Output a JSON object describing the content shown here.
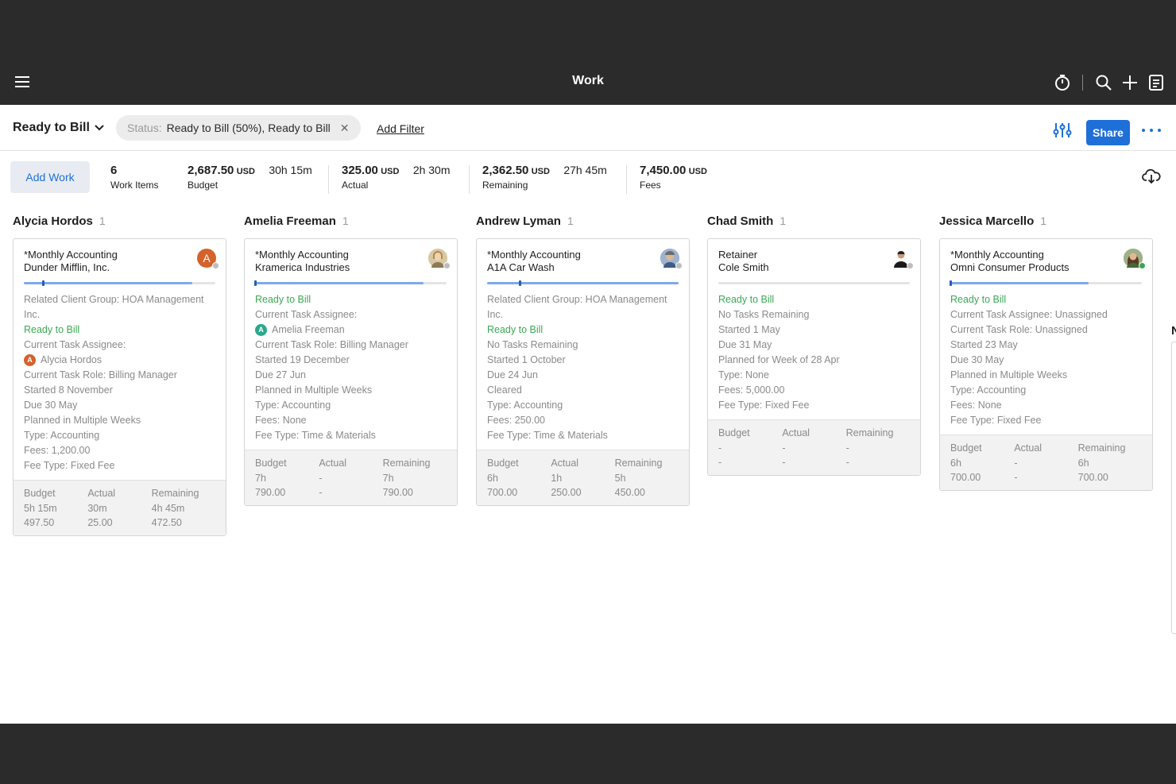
{
  "app_bar": {
    "title": "Work"
  },
  "filter_bar": {
    "view_name": "Ready to Bill",
    "status_chip": {
      "label": "Status:",
      "value": "Ready to Bill (50%), Ready to Bill"
    },
    "add_filter": "Add Filter",
    "share": "Share"
  },
  "summary": {
    "add_work": "Add Work",
    "work_items": {
      "value": "6",
      "label": "Work Items"
    },
    "budget": {
      "amount": "2,687.50",
      "unit": "USD",
      "hours": "30h 15m",
      "label": "Budget"
    },
    "actual": {
      "amount": "325.00",
      "unit": "USD",
      "hours": "2h 30m",
      "label": "Actual"
    },
    "remaining": {
      "amount": "2,362.50",
      "unit": "USD",
      "hours": "27h 45m",
      "label": "Remaining"
    },
    "fees": {
      "amount": "7,450.00",
      "unit": "USD",
      "label": "Fees"
    }
  },
  "foot_labels": {
    "budget": "Budget",
    "actual": "Actual",
    "remaining": "Remaining"
  },
  "columns": [
    {
      "name": "Alycia Hordos",
      "count": "1",
      "card": {
        "title1": "*Monthly Accounting",
        "title2": "Dunder Mifflin, Inc.",
        "progress": 0.88,
        "marker": 0.1,
        "lines": [
          "Related Client Group: HOA Management Inc.",
          "Ready to Bill",
          "Current Task Assignee:",
          "Alycia Hordos",
          "Current Task Role: Billing Manager",
          "Started 8 November",
          "Due 30 May",
          "Planned in Multiple Weeks",
          "Type: Accounting",
          "Fees: 1,200.00",
          "Fee Type: Fixed Fee"
        ],
        "budget": [
          "5h 15m",
          "497.50"
        ],
        "actual": [
          "30m",
          "25.00"
        ],
        "remaining": [
          "4h 45m",
          "472.50"
        ]
      }
    },
    {
      "name": "Amelia Freeman",
      "count": "1",
      "card": {
        "title1": "*Monthly Accounting",
        "title2": "Kramerica Industries",
        "progress": 0.88,
        "marker": 0.0,
        "lines": [
          "Ready to Bill",
          "Current Task Assignee:",
          "Amelia Freeman",
          "Current Task Role: Billing Manager",
          "Started 19 December",
          "Due 27 Jun",
          "Planned in Multiple Weeks",
          "Type: Accounting",
          "Fees: None",
          "Fee Type: Time & Materials"
        ],
        "budget": [
          "7h",
          "790.00"
        ],
        "actual": [
          "-",
          "-"
        ],
        "remaining": [
          "7h",
          "790.00"
        ]
      }
    },
    {
      "name": "Andrew Lyman",
      "count": "1",
      "card": {
        "title1": "*Monthly Accounting",
        "title2": "A1A Car Wash",
        "progress": 1.0,
        "marker": 0.17,
        "lines": [
          "Related Client Group: HOA Management Inc.",
          "Ready to Bill",
          "No Tasks Remaining",
          "Started 1 October",
          "Due 24 Jun",
          "Cleared",
          "Type: Accounting",
          "Fees: 250.00",
          "Fee Type: Time & Materials"
        ],
        "budget": [
          "6h",
          "700.00"
        ],
        "actual": [
          "1h",
          "250.00"
        ],
        "remaining": [
          "5h",
          "450.00"
        ]
      }
    },
    {
      "name": "Chad Smith",
      "count": "1",
      "card": {
        "title1": "Retainer",
        "title2": "Cole Smith",
        "progress": 0.0,
        "marker": -1,
        "lines": [
          "Ready to Bill",
          "No Tasks Remaining",
          "Started 1 May",
          "Due 31 May",
          "Planned for Week of 28 Apr",
          "Type: None",
          "Fees: 5,000.00",
          "Fee Type: Fixed Fee"
        ],
        "budget": [
          "-",
          "-"
        ],
        "actual": [
          "-",
          "-"
        ],
        "remaining": [
          "-",
          "-"
        ]
      }
    },
    {
      "name": "Jessica Marcello",
      "count": "1",
      "card": {
        "title1": "*Monthly Accounting",
        "title2": "Omni Consumer Products",
        "progress": 0.72,
        "marker": 0.0,
        "lines": [
          "Ready to Bill",
          "Current Task Assignee:  Unassigned",
          "Current Task Role: Unassigned",
          "Started 23 May",
          "Due 30 May",
          "Planned in Multiple Weeks",
          "Type: Accounting",
          "Fees: None",
          "Fee Type: Fixed Fee"
        ],
        "budget": [
          "6h",
          "700.00"
        ],
        "actual": [
          "-",
          "-"
        ],
        "remaining": [
          "6h",
          "700.00"
        ]
      }
    }
  ],
  "partial_column_initial": "N",
  "colors": {
    "accent": "#1f6fd8",
    "ready": "#3aa853",
    "progress": "#7ea9e8"
  }
}
